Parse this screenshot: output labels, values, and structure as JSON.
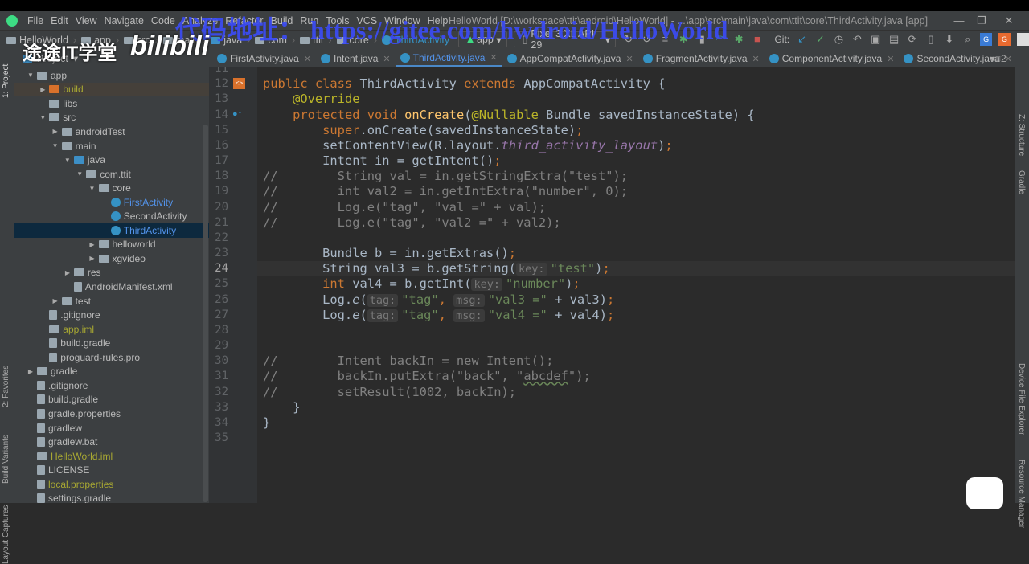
{
  "menubar": {
    "items": [
      "File",
      "Edit",
      "View",
      "Navigate",
      "Code",
      "Analyze",
      "Refactor",
      "Build",
      "Run",
      "Tools",
      "VCS",
      "Window",
      "Help"
    ],
    "title": "HelloWorld [D:\\workspace\\ttit\\android\\HelloWorld] - ...\\app\\src\\main\\java\\com\\ttit\\core\\ThirdActivity.java [app]"
  },
  "breadcrumb": [
    "HelloWorld",
    "app",
    "src",
    "main",
    "java",
    "com",
    "ttit",
    "core",
    "ThirdActivity"
  ],
  "toolbar": {
    "run_config": "app",
    "device": "Pixel 3 XL API 29",
    "git_label": "Git:"
  },
  "project_header": "Project",
  "tabs": [
    {
      "label": "FirstActivity.java",
      "active": false
    },
    {
      "label": "Intent.java",
      "active": false
    },
    {
      "label": "ThirdActivity.java",
      "active": true
    },
    {
      "label": "AppCompatActivity.java",
      "active": false
    },
    {
      "label": "FragmentActivity.java",
      "active": false
    },
    {
      "label": "ComponentActivity.java",
      "active": false
    },
    {
      "label": "SecondActivity.java",
      "active": false
    }
  ],
  "tabs_overflow": "2",
  "left_stripe": [
    "1: Project",
    "2: Favorites",
    "Build Variants",
    "Layout Captures"
  ],
  "right_stripe": [
    "Z: Structure",
    "Gradle",
    "Device File Explorer",
    "Resource Manager"
  ],
  "tree": [
    {
      "label": "app",
      "depth": 0,
      "arrow": "down",
      "icon": "folder"
    },
    {
      "label": "build",
      "depth": 1,
      "arrow": "right",
      "icon": "orange",
      "color": "#a8a832",
      "hl": true
    },
    {
      "label": "libs",
      "depth": 1,
      "arrow": "",
      "icon": "folder"
    },
    {
      "label": "src",
      "depth": 1,
      "arrow": "down",
      "icon": "folder"
    },
    {
      "label": "androidTest",
      "depth": 2,
      "arrow": "right",
      "icon": "folder"
    },
    {
      "label": "main",
      "depth": 2,
      "arrow": "down",
      "icon": "folder"
    },
    {
      "label": "java",
      "depth": 3,
      "arrow": "down",
      "icon": "blue"
    },
    {
      "label": "com.ttit",
      "depth": 4,
      "arrow": "down",
      "icon": "folder"
    },
    {
      "label": "core",
      "depth": 5,
      "arrow": "down",
      "icon": "folder"
    },
    {
      "label": "FirstActivity",
      "depth": 6,
      "arrow": "",
      "icon": "class",
      "color": "#5394ec"
    },
    {
      "label": "SecondActivity",
      "depth": 6,
      "arrow": "",
      "icon": "class"
    },
    {
      "label": "ThirdActivity",
      "depth": 6,
      "arrow": "",
      "icon": "class",
      "color": "#5394ec",
      "sel": true
    },
    {
      "label": "helloworld",
      "depth": 5,
      "arrow": "right",
      "icon": "folder"
    },
    {
      "label": "xgvideo",
      "depth": 5,
      "arrow": "right",
      "icon": "folder"
    },
    {
      "label": "res",
      "depth": 3,
      "arrow": "right",
      "icon": "folder"
    },
    {
      "label": "AndroidManifest.xml",
      "depth": 3,
      "arrow": "",
      "icon": "file"
    },
    {
      "label": "test",
      "depth": 2,
      "arrow": "right",
      "icon": "folder"
    },
    {
      "label": ".gitignore",
      "depth": 1,
      "arrow": "",
      "icon": "file"
    },
    {
      "label": "app.iml",
      "depth": 1,
      "arrow": "",
      "icon": "folder",
      "color": "#a8a832"
    },
    {
      "label": "build.gradle",
      "depth": 1,
      "arrow": "",
      "icon": "file"
    },
    {
      "label": "proguard-rules.pro",
      "depth": 1,
      "arrow": "",
      "icon": "file"
    },
    {
      "label": "gradle",
      "depth": 0,
      "arrow": "right",
      "icon": "folder"
    },
    {
      "label": ".gitignore",
      "depth": 0,
      "arrow": "",
      "icon": "file"
    },
    {
      "label": "build.gradle",
      "depth": 0,
      "arrow": "",
      "icon": "file"
    },
    {
      "label": "gradle.properties",
      "depth": 0,
      "arrow": "",
      "icon": "file"
    },
    {
      "label": "gradlew",
      "depth": 0,
      "arrow": "",
      "icon": "file"
    },
    {
      "label": "gradlew.bat",
      "depth": 0,
      "arrow": "",
      "icon": "file"
    },
    {
      "label": "HelloWorld.iml",
      "depth": 0,
      "arrow": "",
      "icon": "folder",
      "color": "#a8a832"
    },
    {
      "label": "LICENSE",
      "depth": 0,
      "arrow": "",
      "icon": "file"
    },
    {
      "label": "local.properties",
      "depth": 0,
      "arrow": "",
      "icon": "file",
      "color": "#a8a832"
    },
    {
      "label": "settings.gradle",
      "depth": 0,
      "arrow": "",
      "icon": "file"
    }
  ],
  "editor": {
    "current_line": 24,
    "lines": [
      {
        "n": 11,
        "t": []
      },
      {
        "n": 12,
        "t": [
          [
            "public class ",
            "kw"
          ],
          [
            "ThirdActivity ",
            ""
          ],
          [
            "extends ",
            "kw"
          ],
          [
            "AppCompatActivity {",
            ""
          ]
        ]
      },
      {
        "n": 13,
        "t": [
          [
            "    ",
            ""
          ],
          [
            "@Override",
            "an"
          ]
        ]
      },
      {
        "n": 14,
        "t": [
          [
            "    ",
            ""
          ],
          [
            "protected void ",
            "kw"
          ],
          [
            "onCreate",
            "fn"
          ],
          [
            "(",
            ""
          ],
          [
            "@Nullable ",
            "an"
          ],
          [
            "Bundle savedInstanceState) {",
            ""
          ]
        ]
      },
      {
        "n": 15,
        "t": [
          [
            "        ",
            ""
          ],
          [
            "super",
            "kw"
          ],
          [
            ".onCreate(savedInstanceState)",
            ""
          ],
          [
            ";",
            "kw"
          ]
        ]
      },
      {
        "n": 16,
        "t": [
          [
            "        setContentView(R.layout.",
            ""
          ],
          [
            "third_activity_layout",
            "it"
          ],
          [
            ")",
            ""
          ],
          [
            ";",
            "kw"
          ]
        ]
      },
      {
        "n": 17,
        "t": [
          [
            "        Intent in = getIntent()",
            ""
          ],
          [
            ";",
            "kw"
          ]
        ]
      },
      {
        "n": 18,
        "t": [
          [
            "//        String val = in.getStringExtra(\"test\");",
            "cm"
          ]
        ]
      },
      {
        "n": 19,
        "t": [
          [
            "//        int val2 = in.getIntExtra(\"number\", 0);",
            "cm"
          ]
        ]
      },
      {
        "n": 20,
        "t": [
          [
            "//        Log.e(\"tag\", \"val =\" + val);",
            "cm"
          ]
        ]
      },
      {
        "n": 21,
        "t": [
          [
            "//        Log.e(\"tag\", \"val2 =\" + val2);",
            "cm"
          ]
        ]
      },
      {
        "n": 22,
        "t": []
      },
      {
        "n": 23,
        "t": [
          [
            "        Bundle b = in.getExtras()",
            ""
          ],
          [
            ";",
            "kw"
          ]
        ]
      },
      {
        "n": 24,
        "t": [
          [
            "        String val3 = b.getString(",
            ""
          ],
          [
            "key:",
            "hint"
          ],
          [
            "\"test\"",
            "str"
          ],
          [
            ")",
            ""
          ],
          [
            ";",
            "kw"
          ]
        ]
      },
      {
        "n": 25,
        "t": [
          [
            "        ",
            ""
          ],
          [
            "int ",
            "kw"
          ],
          [
            "val4 = b.getInt(",
            ""
          ],
          [
            "key:",
            "hint"
          ],
          [
            "\"number\"",
            "str"
          ],
          [
            ")",
            ""
          ],
          [
            ";",
            "kw"
          ]
        ]
      },
      {
        "n": 26,
        "t": [
          [
            "        Log.",
            ""
          ],
          [
            "e",
            "itn"
          ],
          [
            "(",
            ""
          ],
          [
            "tag:",
            "hint"
          ],
          [
            "\"tag\"",
            "str"
          ],
          [
            ", ",
            "kw"
          ],
          [
            "msg:",
            "hint"
          ],
          [
            "\"val3 =\"",
            "str"
          ],
          [
            " + val3)",
            ""
          ],
          [
            ";",
            "kw"
          ]
        ]
      },
      {
        "n": 27,
        "t": [
          [
            "        Log.",
            ""
          ],
          [
            "e",
            "itn"
          ],
          [
            "(",
            ""
          ],
          [
            "tag:",
            "hint"
          ],
          [
            "\"tag\"",
            "str"
          ],
          [
            ", ",
            "kw"
          ],
          [
            "msg:",
            "hint"
          ],
          [
            "\"val4 =\"",
            "str"
          ],
          [
            " + val4)",
            ""
          ],
          [
            ";",
            "kw"
          ]
        ]
      },
      {
        "n": 28,
        "t": []
      },
      {
        "n": 29,
        "t": []
      },
      {
        "n": 30,
        "t": [
          [
            "//        Intent backIn = new Intent();",
            "cm"
          ]
        ]
      },
      {
        "n": 31,
        "t": [
          [
            "//        backIn.putExtra(\"back\", \"",
            "cm"
          ],
          [
            "abcdef",
            "cm wavy"
          ],
          [
            "\");",
            "cm"
          ]
        ]
      },
      {
        "n": 32,
        "t": [
          [
            "//        setResult(1002, backIn);",
            "cm"
          ]
        ]
      },
      {
        "n": 33,
        "t": [
          [
            "    }",
            ""
          ]
        ]
      },
      {
        "n": 34,
        "t": [
          [
            "}",
            ""
          ]
        ]
      },
      {
        "n": 35,
        "t": []
      }
    ]
  },
  "overlay": {
    "watermark": "代码地址： https://gitee.com/hwdroid/HelloWorld",
    "brand": "途途IT学堂",
    "bili_logo": "bilibili"
  }
}
